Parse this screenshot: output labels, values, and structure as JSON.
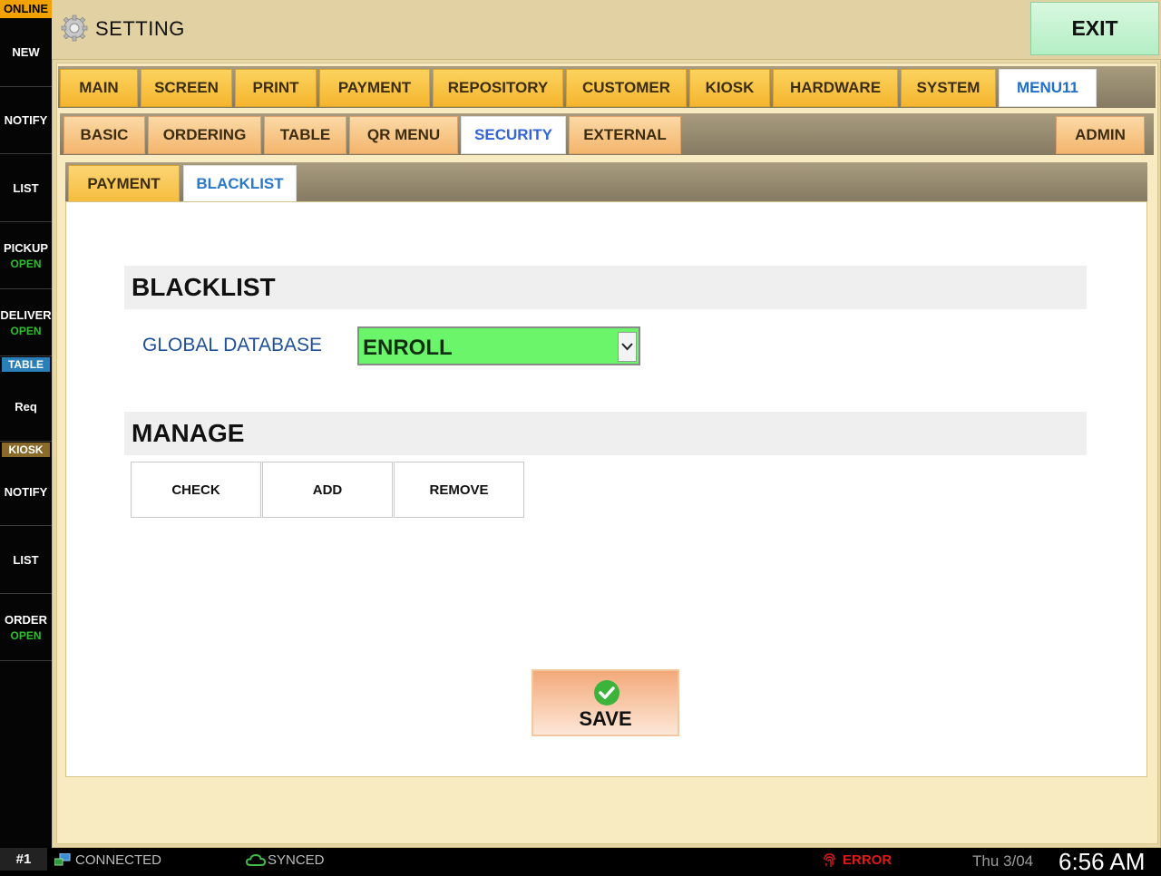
{
  "sidebar": {
    "status": "ONLINE",
    "items": [
      {
        "label": "NEW",
        "sub": ""
      },
      {
        "label": "NOTIFY",
        "sub": ""
      },
      {
        "label": "LIST",
        "sub": ""
      },
      {
        "label": "PICKUP",
        "sub": "OPEN"
      },
      {
        "label": "DELIVER",
        "sub": "OPEN"
      },
      {
        "label": "Req",
        "sub": ""
      },
      {
        "label": "NOTIFY",
        "sub": ""
      },
      {
        "label": "LIST",
        "sub": ""
      },
      {
        "label": "ORDER",
        "sub": "OPEN"
      }
    ],
    "table_label": "TABLE",
    "kiosk_label": "KIOSK",
    "colors": {
      "online_bg": "#f2a200",
      "table_bg": "#2a7fb8",
      "kiosk_bg": "#8a6a2a",
      "open_text": "#2fbf2f"
    }
  },
  "header": {
    "title": "SETTING",
    "icon": "gear-icon",
    "exit_label": "EXIT"
  },
  "tabs_main": [
    {
      "label": "MAIN",
      "active": false
    },
    {
      "label": "SCREEN",
      "active": false
    },
    {
      "label": "PRINT",
      "active": false
    },
    {
      "label": "PAYMENT",
      "active": false
    },
    {
      "label": "REPOSITORY",
      "active": false
    },
    {
      "label": "CUSTOMER",
      "active": false
    },
    {
      "label": "KIOSK",
      "active": false
    },
    {
      "label": "HARDWARE",
      "active": false
    },
    {
      "label": "SYSTEM",
      "active": false
    },
    {
      "label": "MENU11",
      "active": true
    }
  ],
  "tabs_sub": [
    {
      "label": "BASIC",
      "active": false
    },
    {
      "label": "ORDERING",
      "active": false
    },
    {
      "label": "TABLE",
      "active": false
    },
    {
      "label": "QR MENU",
      "active": false
    },
    {
      "label": "SECURITY",
      "active": true
    },
    {
      "label": "EXTERNAL",
      "active": false
    }
  ],
  "admin_label": "ADMIN",
  "tabs_third": [
    {
      "label": "PAYMENT",
      "active": false
    },
    {
      "label": "BLACKLIST",
      "active": true
    }
  ],
  "blacklist": {
    "section_title": "BLACKLIST",
    "global_db_label": "GLOBAL DATABASE",
    "global_db_value": "ENROLL",
    "global_db_color": "#6bf56b"
  },
  "manage": {
    "section_title": "MANAGE",
    "buttons": [
      "CHECK",
      "ADD",
      "REMOVE"
    ]
  },
  "save_label": "SAVE",
  "statusbar": {
    "terminal": "#1",
    "connection": "CONNECTED",
    "sync": "SYNCED",
    "error": "ERROR",
    "date": "Thu 3/04",
    "time": "6:56 AM"
  }
}
